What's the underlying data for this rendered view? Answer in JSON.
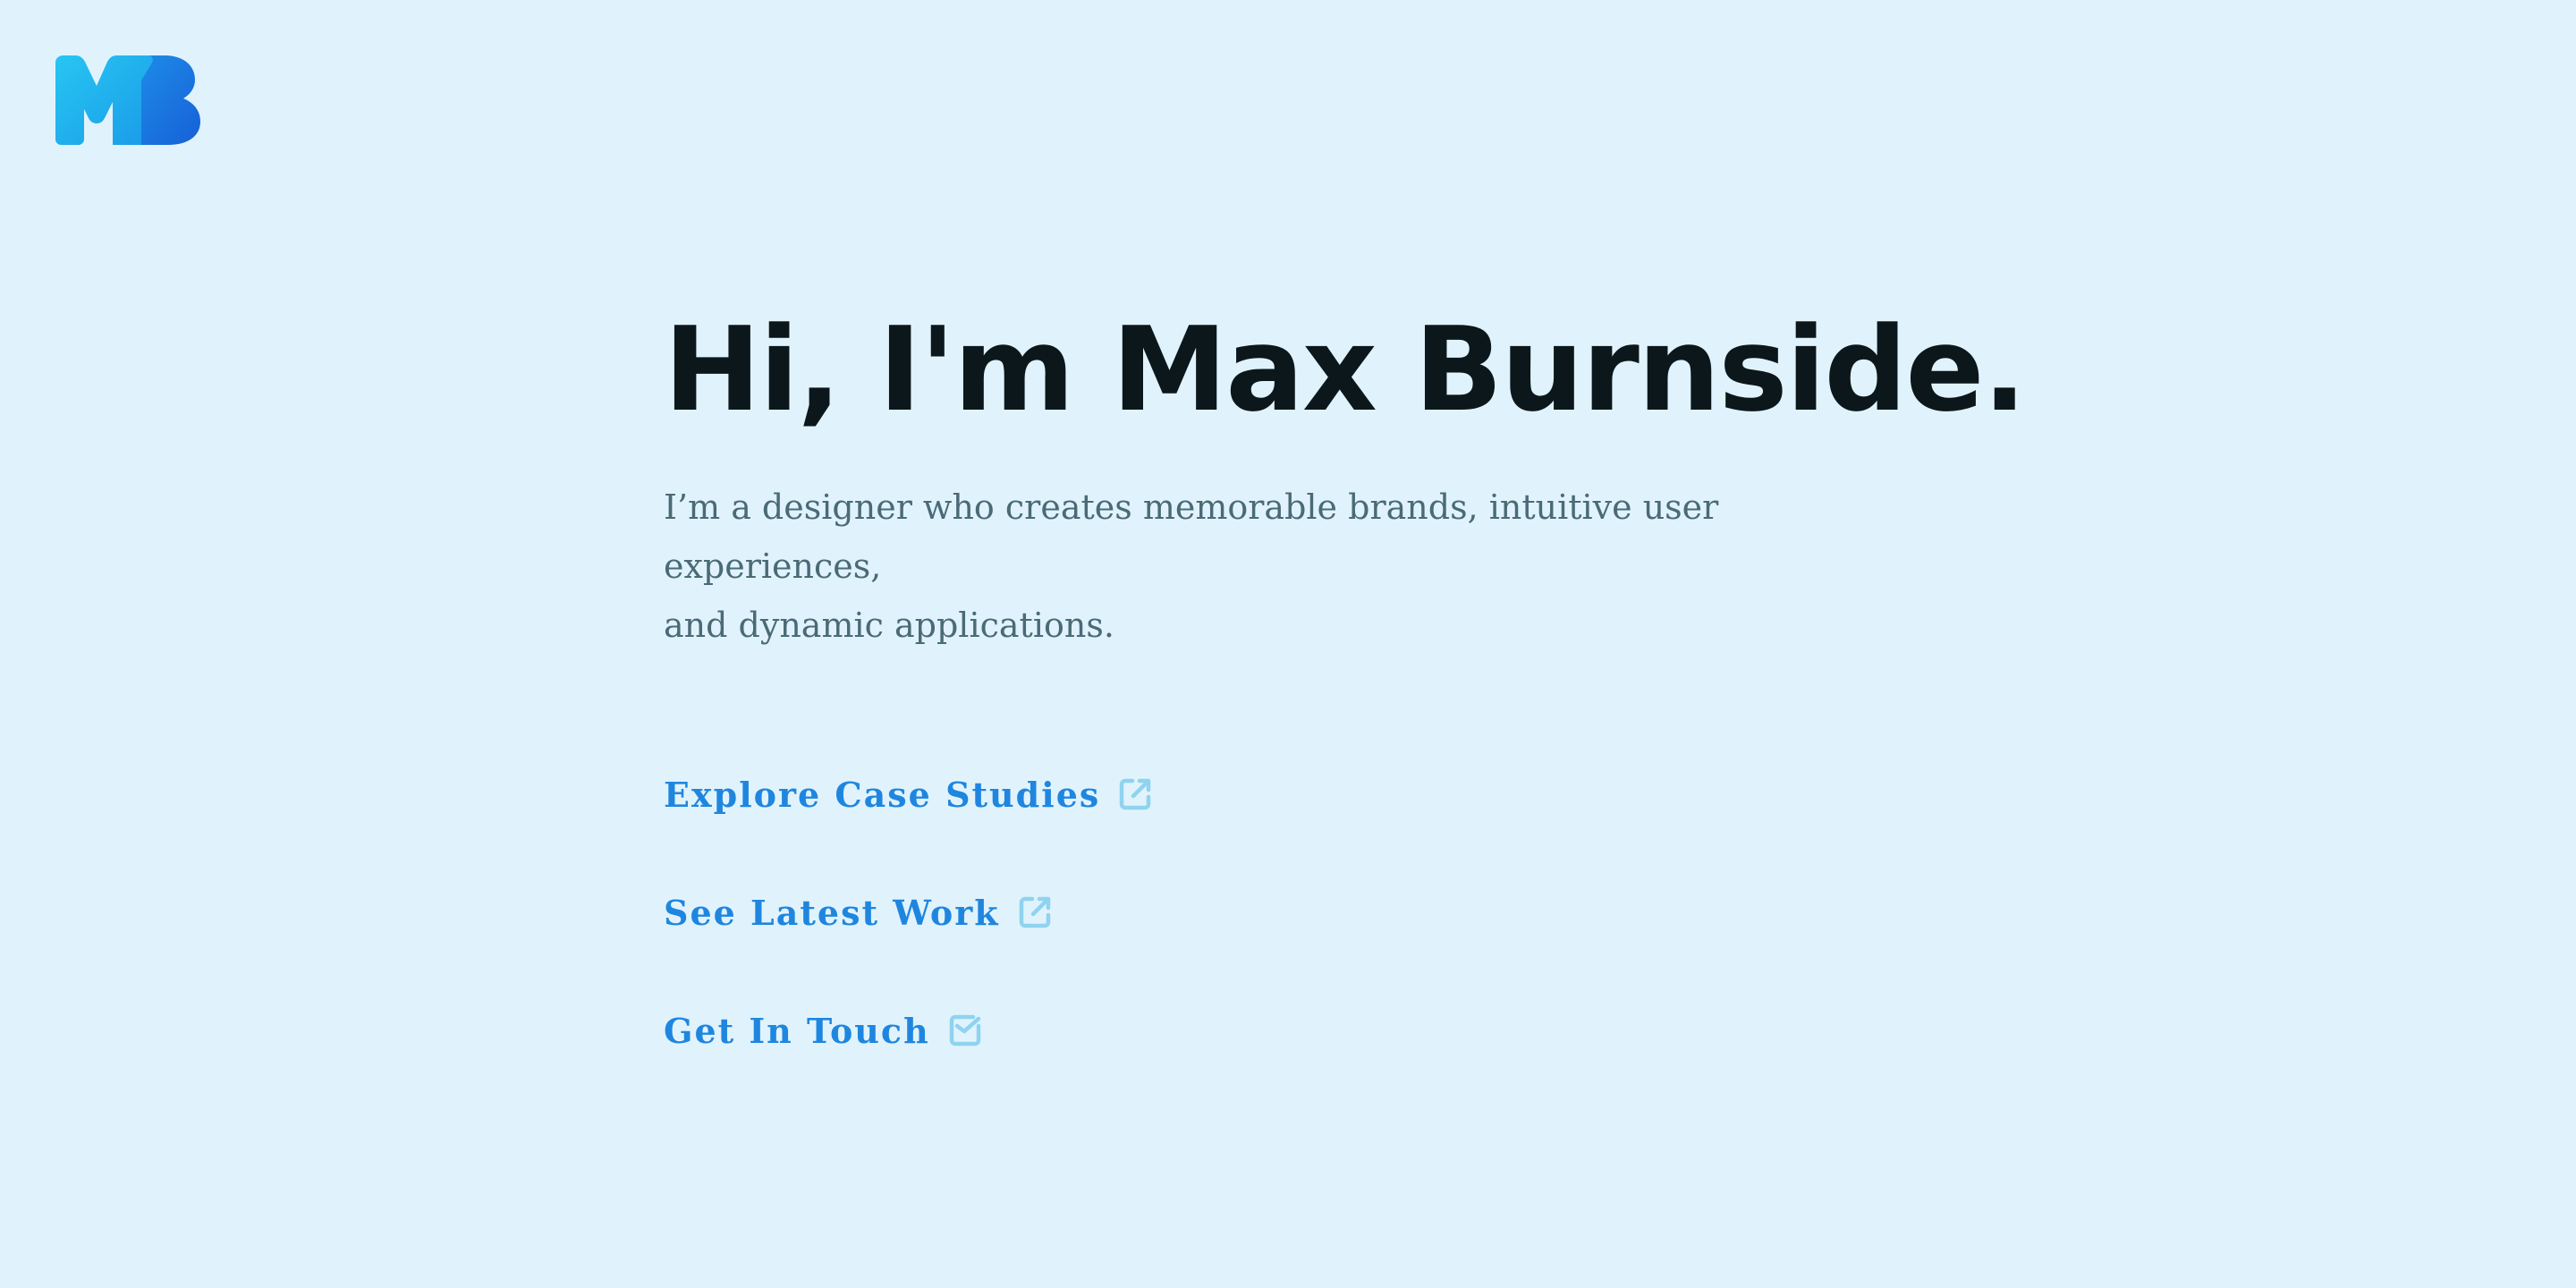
{
  "brand": {
    "logo_text": "MB",
    "colors": {
      "logo_cyan": "#22c5ee",
      "logo_blue": "#1b73e8",
      "background": "#e0f3fc",
      "headline": "#0c171c",
      "body_text": "#4a6a76",
      "link": "#1f86e0",
      "link_icon": "#8fd3f0"
    }
  },
  "hero": {
    "headline": "Hi, I'm Max Burnside.",
    "tagline_line1": "I’m a designer who creates memorable brands, intuitive user experiences,",
    "tagline_line2": "and dynamic applications."
  },
  "links": [
    {
      "label": "Explore Case Studies",
      "icon": "external-link-icon"
    },
    {
      "label": "See Latest Work",
      "icon": "external-link-icon"
    },
    {
      "label": "Get In Touch",
      "icon": "mail-check-icon"
    }
  ]
}
